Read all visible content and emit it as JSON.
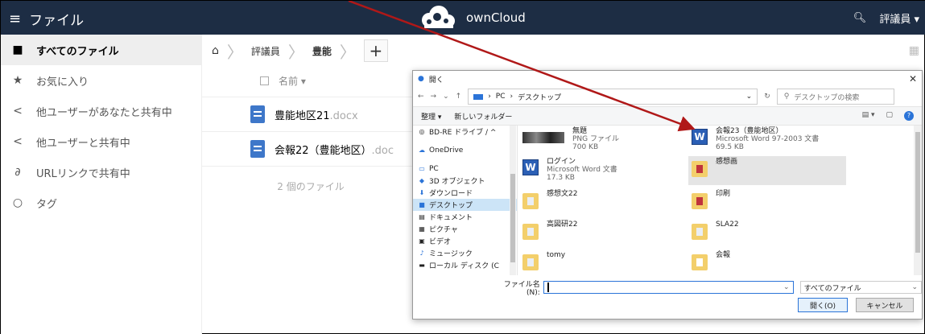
{
  "topbar": {
    "menu_icon": "hamburger-icon",
    "menu_label": "ファイル",
    "logo_text": "ownCloud",
    "user": "評議員",
    "search_icon": "search-icon"
  },
  "sidebar": {
    "items": [
      {
        "label": "すべてのファイル",
        "icon": "folder-icon",
        "active": true
      },
      {
        "label": "お気に入り",
        "icon": "star-icon"
      },
      {
        "label": "他ユーザーがあなたと共有中",
        "icon": "share-icon"
      },
      {
        "label": "他ユーザーと共有中",
        "icon": "share-icon"
      },
      {
        "label": "URLリンクで共有中",
        "icon": "link-icon"
      },
      {
        "label": "タグ",
        "icon": "tag-icon"
      }
    ]
  },
  "breadcrumb": {
    "items": [
      "評議員",
      "豊能"
    ],
    "add_label": "+"
  },
  "filelist": {
    "header_name": "名前",
    "files": [
      {
        "name": "豊能地区21",
        "ext": ".docx"
      },
      {
        "name": "会報22（豊能地区）",
        "ext": ".doc"
      }
    ],
    "count": "2 個のファイル"
  },
  "dialog": {
    "title": "開く",
    "path": [
      "PC",
      "デスクトップ"
    ],
    "search_placeholder": "デスクトップの検索",
    "toolbar": {
      "organize": "整理 ▾",
      "new_folder": "新しいフォルダー"
    },
    "nav": [
      {
        "label": "BD-RE ドライブ ∕ ^",
        "icon": "drive-icon"
      },
      {
        "label": "OneDrive",
        "icon": "cloud-icon"
      },
      {
        "label": "PC",
        "icon": "pc-icon"
      },
      {
        "label": "3D オブジェクト",
        "icon": "cube-icon"
      },
      {
        "label": "ダウンロード",
        "icon": "download-icon"
      },
      {
        "label": "デスクトップ",
        "icon": "desktop-icon",
        "selected": true
      },
      {
        "label": "ドキュメント",
        "icon": "document-icon"
      },
      {
        "label": "ピクチャ",
        "icon": "picture-icon"
      },
      {
        "label": "ビデオ",
        "icon": "video-icon"
      },
      {
        "label": "ミュージック",
        "icon": "music-icon"
      },
      {
        "label": "ローカル ディスク (C",
        "icon": "disk-icon"
      }
    ],
    "files": [
      {
        "name": "無題",
        "line2": "PNG ファイル",
        "line3": "700 KB",
        "kind": "image"
      },
      {
        "name": "会報23（豊能地区）",
        "line2": "Microsoft Word 97-2003 文書",
        "line3": "69.5 KB",
        "kind": "word"
      },
      {
        "name": "ログイン",
        "line2": "Microsoft Word 文書",
        "line3": "17.3 KB",
        "kind": "word"
      },
      {
        "name": "感想画",
        "line2": "",
        "line3": "",
        "kind": "folder-red",
        "selected": true
      },
      {
        "name": "感想文22",
        "line2": "",
        "line3": "",
        "kind": "folder"
      },
      {
        "name": "印刷",
        "line2": "",
        "line3": "",
        "kind": "folder-red"
      },
      {
        "name": "高図研22",
        "line2": "",
        "line3": "",
        "kind": "folder"
      },
      {
        "name": "SLA22",
        "line2": "",
        "line3": "",
        "kind": "folder"
      },
      {
        "name": "tomy",
        "line2": "",
        "line3": "",
        "kind": "folder"
      },
      {
        "name": "会報",
        "line2": "",
        "line3": "",
        "kind": "folder-plain"
      }
    ],
    "filename_label": "ファイル名(N):",
    "filename_value": "",
    "filter": "すべてのファイル",
    "open_button": "開く(O)",
    "cancel_button": "キャンセル"
  },
  "colors": {
    "topbar": "#1d2d44",
    "accent": "#2b74d8",
    "arrow": "#b01818"
  }
}
